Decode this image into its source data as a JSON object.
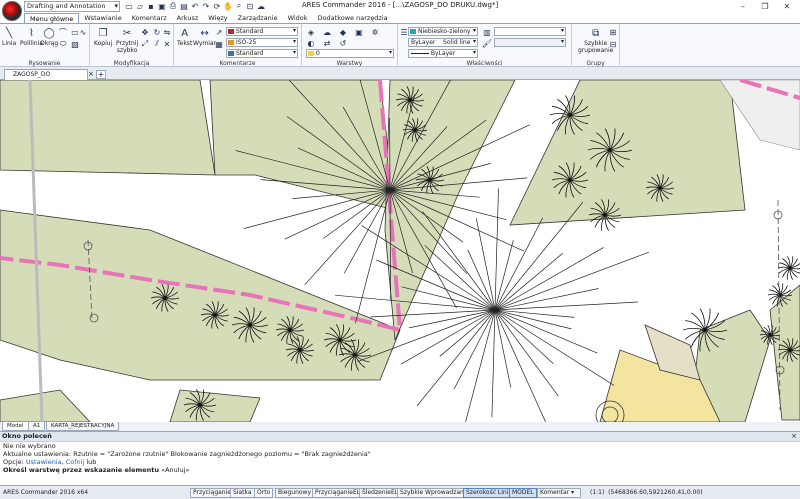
{
  "titlebar": {
    "workspace": "Drafting and Annotation",
    "title": "ARES Commander 2016 - [...\\ZAGOSP_DO DRUKU.dwg*]",
    "qat_icons": [
      "new-icon",
      "open-icon",
      "save-icon",
      "save-as-icon",
      "print-icon",
      "print-preview-icon",
      "undo-icon",
      "redo-icon",
      "rebuild-icon",
      "pan-icon",
      "zoom-icon",
      "zoom-window-icon",
      "cloud-icon"
    ],
    "minimize": "–",
    "maximize": "❐",
    "close": "✕"
  },
  "ribbon_tabs": [
    {
      "label": "Menu główne",
      "active": true
    },
    {
      "label": "Wstawianie",
      "active": false
    },
    {
      "label": "Komentarz",
      "active": false
    },
    {
      "label": "Arkusz",
      "active": false
    },
    {
      "label": "Więzy",
      "active": false
    },
    {
      "label": "Zarządzanie",
      "active": false
    },
    {
      "label": "Widok",
      "active": false
    },
    {
      "label": "Dodatkowe narzędzia",
      "active": false
    }
  ],
  "ribbon": {
    "rysowanie": {
      "title": "Rysowanie",
      "linia": "Linia",
      "polilinia": "Polilinia",
      "okrag": "Okrąg"
    },
    "modyfikacja": {
      "title": "Modyfikacja",
      "kopiuj": "Kopiuj",
      "przytnij": "Przytnij",
      "szybko": "szybko"
    },
    "komentarze": {
      "title": "Komentarze",
      "tekst": "Tekst",
      "wymiar": "Wymiar",
      "text_style": "Standard",
      "dim_style": "ISO-25",
      "table_style": "Standard"
    },
    "warstwy": {
      "title": "Warstwy",
      "layer": "0"
    },
    "wlasciwosci": {
      "title": "Właściwości",
      "color": "Niebiesko-zielony",
      "linetype_layer": "ByLayer",
      "linetype_name": "Solid line",
      "lineweight": "ByLayer",
      "color_swatch": "#2aa6a6"
    },
    "grupy": {
      "title": "Grupy",
      "szybkie": "Szybkie",
      "grupowanie": "grupowanie"
    }
  },
  "doc_tab": {
    "name": "ZAGOSP_DO DRUKU.dwg*",
    "close": "×",
    "add": "+"
  },
  "layout_tabs": [
    {
      "label": "Model",
      "active": true
    },
    {
      "label": "A1",
      "active": false
    },
    {
      "label": "KARTA_REJESTRACYJNA",
      "active": false
    }
  ],
  "command": {
    "title": "Okno poleceń",
    "close": "×",
    "line1": "Nie nie wybrano",
    "line2": "Aktualne ustawienia: Rzutnie = \"Zarożone rzutnie\" Blokowanie zagnieżdżonego poziomu = \"Brak zagnieżdżenia\"",
    "line3_prefix": "Opcje: ",
    "line3_opt1": "Ustawienia",
    "line3_sep": ", ",
    "line3_opt2": "Cofnij",
    "line3_suffix": " lub",
    "prompt": "Określ warstwę przez wskazanie elementu",
    "prompt_suffix": " «Anuluj»"
  },
  "statusbar": {
    "app": "ARES Commander 2016 x64",
    "buttons": [
      {
        "label": "Przyciąganie",
        "on": false
      },
      {
        "label": "Siatka",
        "on": false
      },
      {
        "label": "Orto",
        "on": false
      },
      {
        "label": "Biegunowy",
        "on": false
      },
      {
        "label": "PrzyciąganieEL",
        "on": false
      },
      {
        "label": "ŚledzenieEL",
        "on": false
      },
      {
        "label": "Szybkie Wprowadzanie",
        "on": false
      },
      {
        "label": "Szerokość Linii",
        "on": true
      },
      {
        "label": "MODEL",
        "on": true
      }
    ],
    "annotation": "Komentar",
    "scale": "(1:1)",
    "coords": "(5468366.60,5921260.41,0.00)"
  },
  "colors": {
    "area_fill": "#d5ddb8",
    "boundary_pink": "#e873b8",
    "sand": "#f3e4a0",
    "pave_grey": "#dcdcdc"
  }
}
